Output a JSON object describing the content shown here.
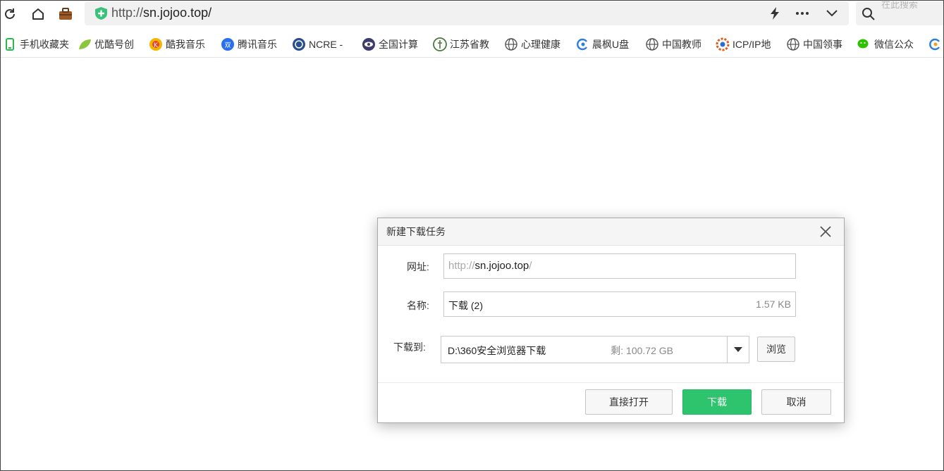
{
  "address_bar": {
    "scheme": "http://",
    "host_path": "sn.jojoo.top/"
  },
  "search": {
    "placeholder": "在此搜索"
  },
  "bookmarks": [
    {
      "label": "手机收藏夹",
      "icon": "phone-icon"
    },
    {
      "label": "优酷号创",
      "icon": "leaf-icon"
    },
    {
      "label": "酷我音乐",
      "icon": "kuwo-icon"
    },
    {
      "label": "腾讯音乐",
      "icon": "tencent-music-icon"
    },
    {
      "label": "NCRE -",
      "icon": "ncre-icon"
    },
    {
      "label": "全国计算",
      "icon": "eye-logo-icon"
    },
    {
      "label": "江苏省教",
      "icon": "seal-icon"
    },
    {
      "label": "心理健康",
      "icon": "globe-icon"
    },
    {
      "label": "晨枫U盘",
      "icon": "swirl-icon"
    },
    {
      "label": "中国教师",
      "icon": "globe-icon"
    },
    {
      "label": "ICP/IP地",
      "icon": "gear-logo-icon"
    },
    {
      "label": "中国领事",
      "icon": "globe-icon"
    },
    {
      "label": "微信公众",
      "icon": "wechat-icon"
    }
  ],
  "dialog": {
    "title": "新建下载任务",
    "url_label": "网址:",
    "url_dim_prefix": "http://",
    "url_main": "sn.jojoo.top",
    "url_dim_suffix": "/",
    "name_label": "名称:",
    "name_value": "下载 (2)",
    "name_size": "1.57 KB",
    "save_to_label": "下载到:",
    "save_path": "D:\\360安全浏览器下载",
    "free_space": "剩: 100.72 GB",
    "browse_label": "浏览",
    "open_direct_label": "直接打开",
    "download_label": "下载",
    "cancel_label": "取消"
  },
  "colors": {
    "accent_green": "#2ec46e",
    "shield_green": "#3ac27a"
  }
}
